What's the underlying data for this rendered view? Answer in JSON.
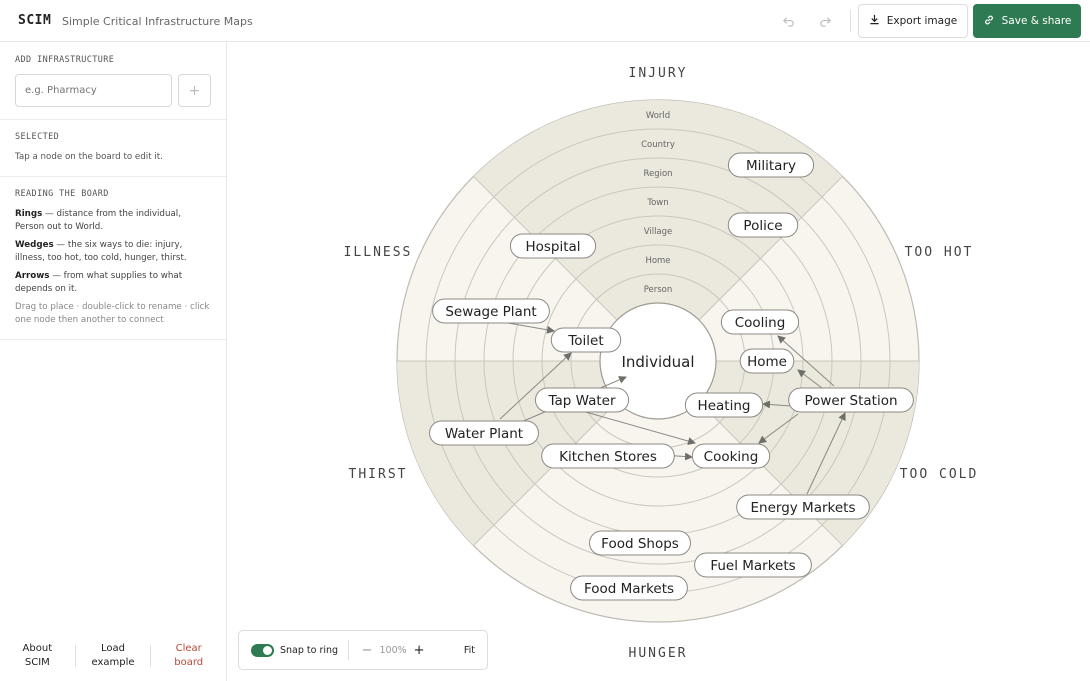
{
  "app": {
    "brand": "SCIM",
    "tagline": "Simple Critical Infrastructure Maps"
  },
  "toolbar": {
    "export_label": "Export image",
    "save_label": "Save & share",
    "accent": "#2e7a52"
  },
  "sidebar": {
    "add": {
      "title": "ADD INFRASTRUCTURE",
      "placeholder": "e.g. Pharmacy"
    },
    "selected": {
      "title": "SELECTED",
      "hint": "Tap a node on the board to edit it."
    },
    "reading": {
      "title": "READING THE BOARD",
      "rings_term": "Rings",
      "rings_text": " — distance from the individual, Person out to World.",
      "wedges_term": "Wedges",
      "wedges_text": " — the six ways to die: injury, illness, too hot, too cold, hunger, thirst.",
      "arrows_term": "Arrows",
      "arrows_text": " — from what supplies to what depends on it.",
      "tip": "Drag to place · double-click to rename · click one node then another to connect"
    },
    "footer": {
      "about_1": "About",
      "about_2": "SCIM",
      "load_1": "Load",
      "load_2": "example",
      "clear_1": "Clear",
      "clear_2": "board"
    }
  },
  "board": {
    "center_label": "Individual",
    "rings": [
      "Person",
      "Home",
      "Village",
      "Town",
      "Region",
      "Country",
      "World"
    ],
    "wedges": [
      "INJURY",
      "TOO HOT",
      "TOO COLD",
      "HUNGER",
      "THIRST",
      "ILLNESS"
    ],
    "nodes": [
      "Military",
      "Police",
      "Hospital",
      "Sewage Plant",
      "Toilet",
      "Cooling",
      "Home",
      "Power Station",
      "Heating",
      "Tap Water",
      "Water Plant",
      "Kitchen Stores",
      "Cooking",
      "Energy Markets",
      "Food Shops",
      "Fuel Markets",
      "Food Markets"
    ]
  },
  "zoom": {
    "snap_label": "Snap to ring",
    "snap_on": true,
    "value": "100%",
    "fit_label": "Fit"
  }
}
